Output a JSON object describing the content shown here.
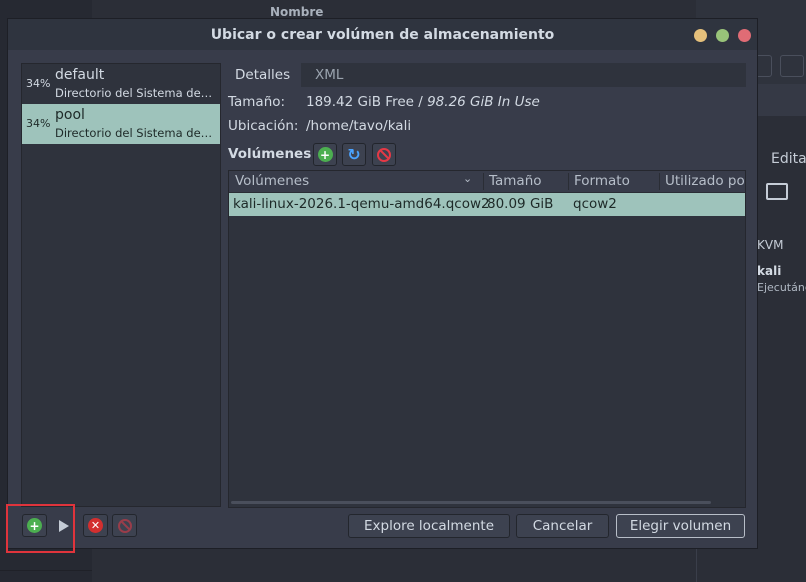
{
  "background": {
    "column_header": "Nombre",
    "right_panel": {
      "edit_label": "Edita",
      "kvm_label": "KVM",
      "vm_name": "kali",
      "vm_status": "Ejecutánc"
    }
  },
  "dialog": {
    "title": "Ubicar o crear volúmen de almacenamiento"
  },
  "pools": [
    {
      "percent": "34%",
      "name": "default",
      "description": "Directorio del Sistema de archivos",
      "selected": false
    },
    {
      "percent": "34%",
      "name": "pool",
      "description": "Directorio del Sistema de archivos",
      "selected": true
    }
  ],
  "tabs": [
    {
      "label": "Detalles",
      "active": true
    },
    {
      "label": "XML",
      "active": false
    }
  ],
  "details": {
    "size_label": "Tamaño:",
    "size_free": "189.42 GiB Free",
    "size_sep": " / ",
    "size_in_use": "98.26 GiB In Use",
    "location_label": "Ubicación:",
    "location_value": "/home/tavo/kali",
    "volumes_label": "Volúmenes"
  },
  "volume_table": {
    "columns": [
      "Volúmenes",
      "Tamaño",
      "Formato",
      "Utilizado po"
    ],
    "rows": [
      {
        "name": "kali-linux-2026.1-qemu-amd64.qcow2",
        "size": "80.09 GiB",
        "format": "qcow2",
        "used_by": ""
      }
    ]
  },
  "buttons": {
    "browse_local": "Explore localmente",
    "cancel": "Cancelar",
    "choose_volume": "Elegir volumen"
  },
  "colors": {
    "selection": "#9ec3bb",
    "highlight_box": "#e0343c",
    "add_green": "#4caf50",
    "stop_red": "#e53946"
  }
}
